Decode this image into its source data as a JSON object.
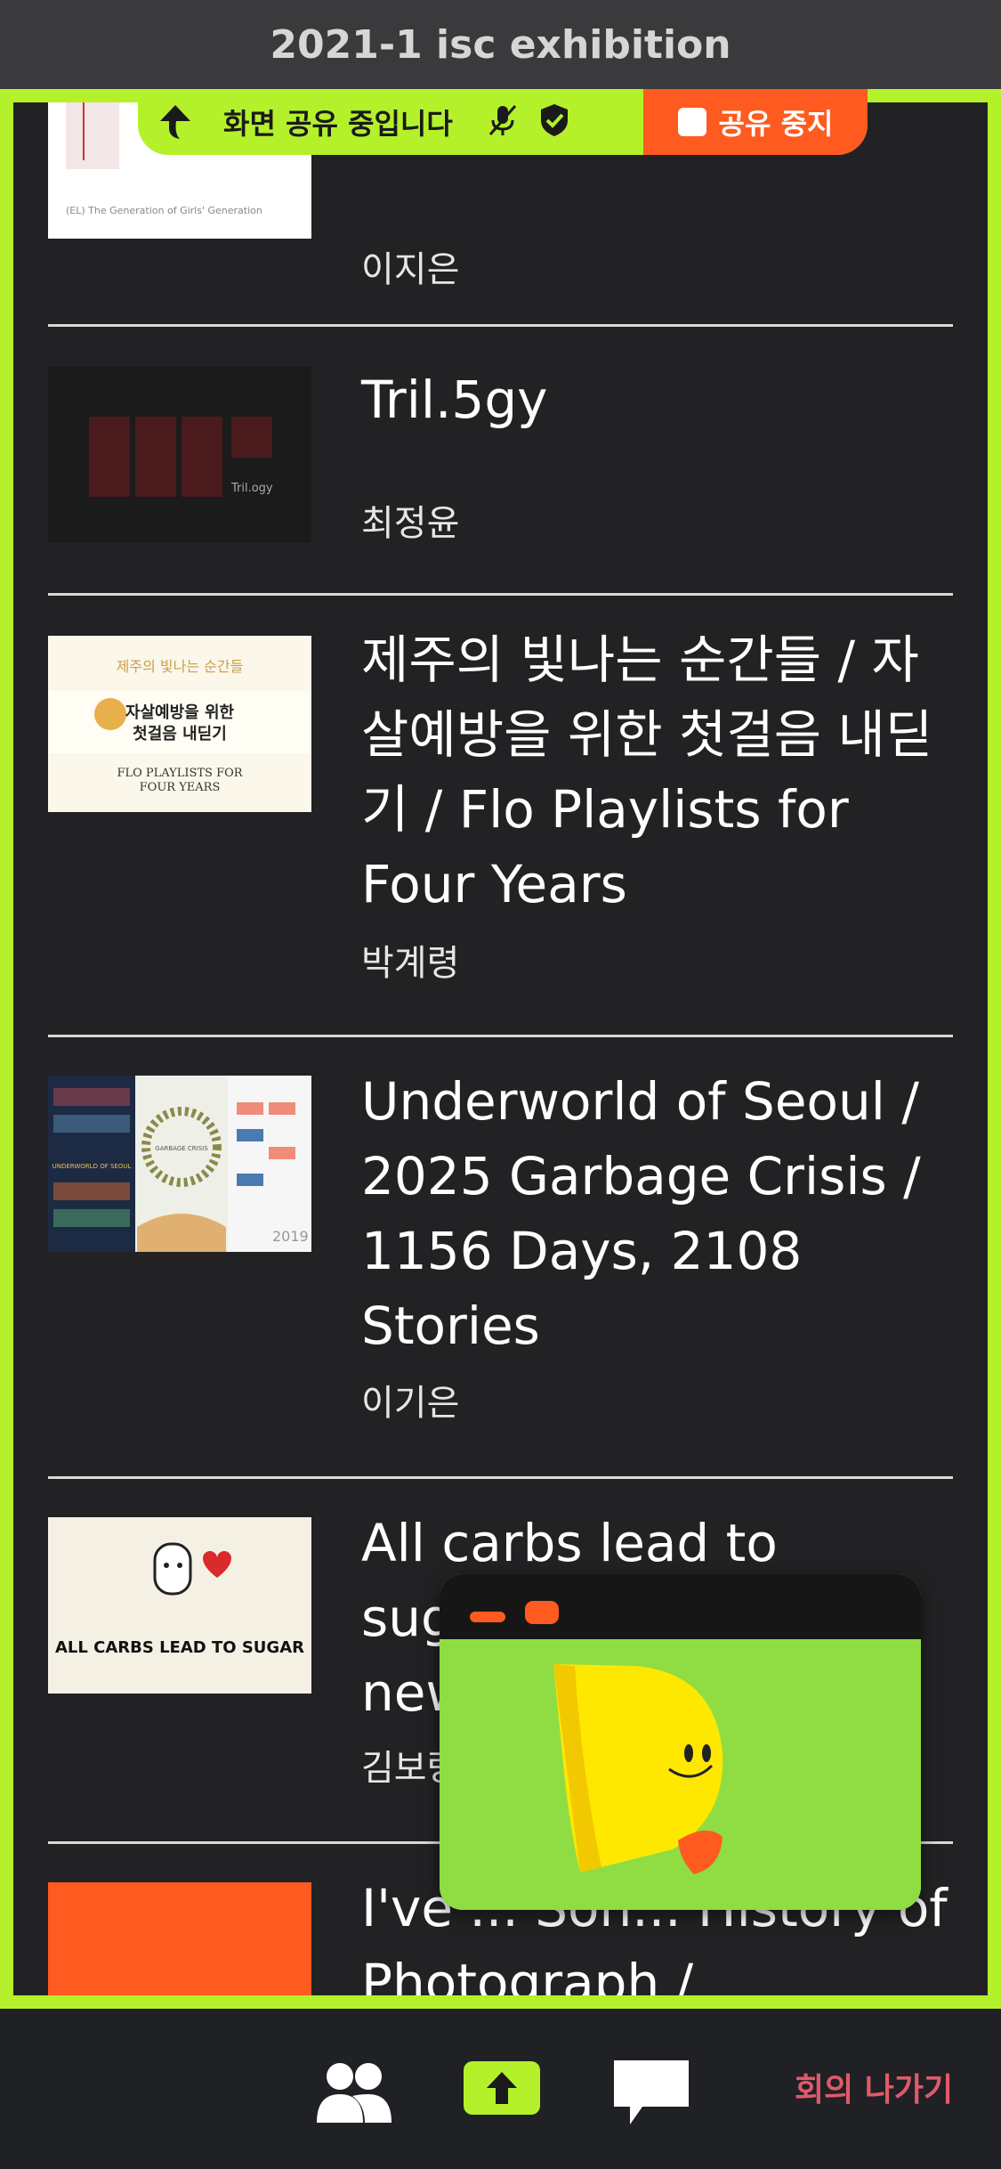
{
  "app": {
    "title": "2021-1 isc exhibition"
  },
  "share_bar": {
    "status_label": "화면 공유 중입니다",
    "stop_label": "공유 중지",
    "icons": [
      "back-arrow-icon",
      "mic-muted-icon",
      "shield-check-icon"
    ]
  },
  "projects": [
    {
      "title": "",
      "author": "이지은"
    },
    {
      "title": "Tril.5gy",
      "author": "최정윤",
      "thumb_caption": "Tril.ogy"
    },
    {
      "title": "제주의 빛나는 순간들 / 자살예방을 위한 첫걸음 내딛기 / Flo Playlists for Four Years",
      "author": "박계령",
      "thumb_lines": [
        "제주의 빛나는 순간들",
        "자살예방을 위한",
        "첫걸음 내딛기",
        "FLO PLAYLISTS FOR",
        "FOUR YEARS"
      ]
    },
    {
      "title": "Underworld of Seoul / 2025 Garbage Crisis / 1156 Days, 2108 Stories",
      "author": "이기은",
      "thumb_lines": [
        "UNDERWORLD OF SEOUL",
        "GARBAGE CRISIS",
        "2019"
      ]
    },
    {
      "title": "All carbs lead to sugar/ Islands of newborn ento...",
      "author": "김보랑",
      "thumb_caption": "ALL CARBS LEAD TO SUGAR"
    },
    {
      "title": "I've ... Son... History of Photograph /",
      "author": ""
    }
  ],
  "floating_video": {
    "accent": "#ff5a1f",
    "bg": "#8fdd42"
  },
  "bottom_bar": {
    "leave_label": "회의 나가기",
    "icons": [
      "participants-icon",
      "share-screen-icon",
      "chat-icon"
    ]
  },
  "colors": {
    "share_border": "#b4f12a",
    "stop": "#ff5a1f",
    "leave": "#e05a6a",
    "bg": "#222224"
  }
}
